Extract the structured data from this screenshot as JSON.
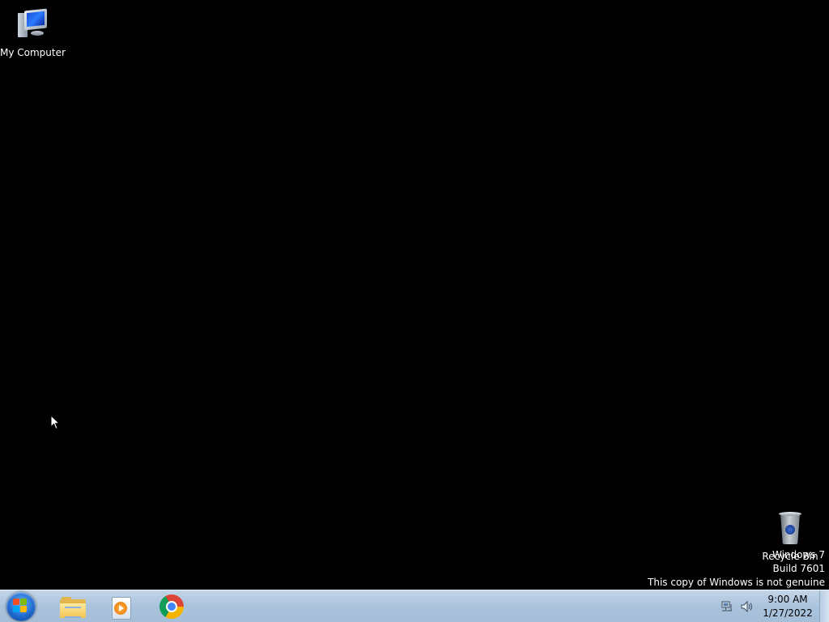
{
  "desktop": {
    "background_color": "#000000",
    "icons": [
      {
        "label": "My Computer",
        "icon": "computer-icon"
      },
      {
        "label": "Recycle Bin",
        "icon": "recycle-bin-icon"
      }
    ],
    "watermark": {
      "line1": "Windows 7",
      "line2": "Build 7601",
      "line3": "This copy of Windows is not genuine"
    }
  },
  "taskbar": {
    "start": {
      "icon": "windows-start-orb-icon"
    },
    "pinned": [
      {
        "app": "Windows Explorer",
        "icon": "folder-icon"
      },
      {
        "app": "Windows Media Player",
        "icon": "media-player-icon"
      },
      {
        "app": "Google Chrome",
        "icon": "chrome-icon"
      }
    ],
    "tray": {
      "network_icon": "network-icon",
      "volume_icon": "volume-icon"
    },
    "clock": {
      "time": "9:00 AM",
      "date": "1/27/2022"
    },
    "colors": {
      "bar": "#aac3dd"
    }
  }
}
